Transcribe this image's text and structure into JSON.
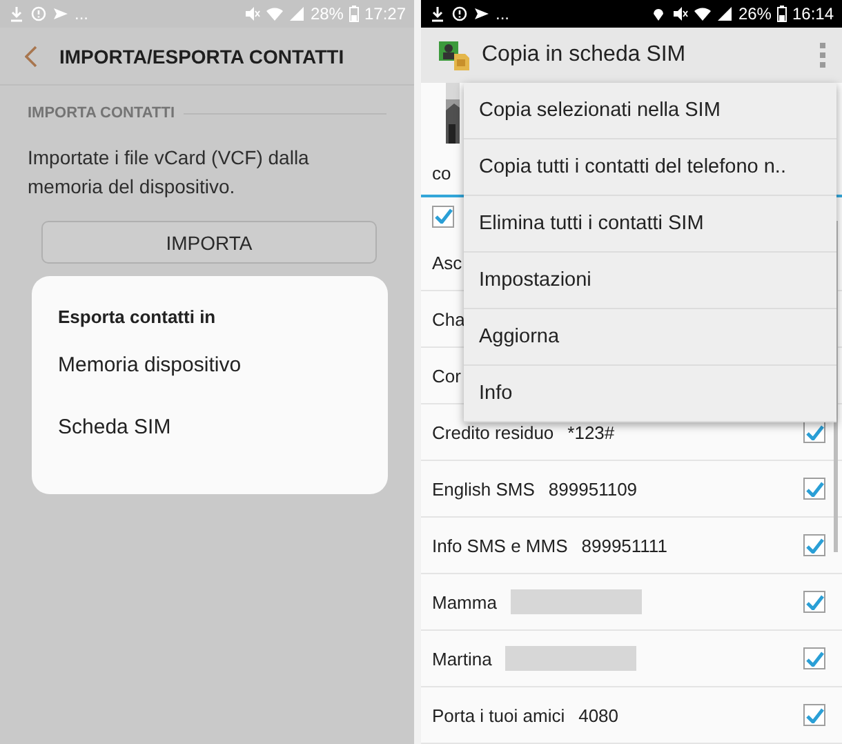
{
  "left_screen": {
    "status_bar": {
      "overflow": "...",
      "battery": "28%",
      "time": "17:27"
    },
    "header": {
      "title": "IMPORTA/ESPORTA CONTATTI"
    },
    "import_section": {
      "heading": "IMPORTA CONTATTI",
      "description": "Importate i file vCard (VCF) dalla memoria del dispositivo.",
      "button": "IMPORTA"
    },
    "dialog": {
      "title": "Esporta contatti in",
      "options": [
        "Memoria dispositivo",
        "Scheda SIM"
      ]
    }
  },
  "right_screen": {
    "status_bar": {
      "overflow": "...",
      "battery": "26%",
      "time": "16:14"
    },
    "app_bar": {
      "title": "Copia in scheda SIM"
    },
    "tab_label": "co",
    "select_all": {
      "checked": true
    },
    "contacts": [
      {
        "name": "Asc"
      },
      {
        "name": "Cha"
      },
      {
        "name": "Cor"
      },
      {
        "name": "Credito residuo",
        "number": "*123#",
        "checked": true
      },
      {
        "name": "English SMS",
        "number": "899951109",
        "checked": true
      },
      {
        "name": "Info SMS e MMS",
        "number": "899951111",
        "checked": true
      },
      {
        "name": "Mamma",
        "redacted": true,
        "checked": true
      },
      {
        "name": "Martina",
        "redacted": true,
        "checked": true
      },
      {
        "name": "Porta i tuoi amici",
        "number": "4080",
        "checked": true
      }
    ],
    "menu": {
      "items": [
        "Copia selezionati nella SIM",
        "Copia tutti i contatti del telefono n..",
        "Elimina tutti i contatti SIM",
        "Impostazioni",
        "Aggiorna",
        "Info"
      ]
    }
  }
}
